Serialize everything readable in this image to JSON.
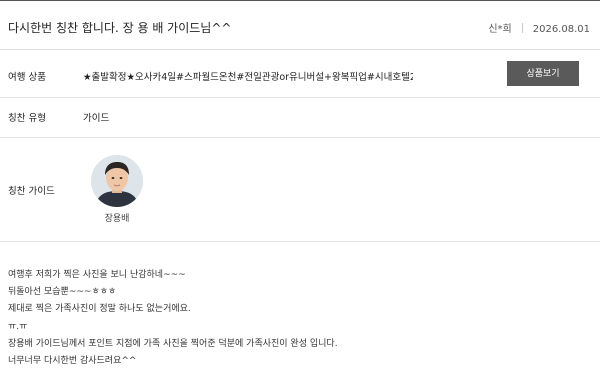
{
  "header": {
    "title": "다시한번 칭찬 합니다. 장 용 배 가이드님^^",
    "author": "신*희",
    "date": "2026.08.01"
  },
  "rows": {
    "product": {
      "label": "여행 상품",
      "value": "★출발확정★오사카4일#스파월드온천#전일관광or유니버설+왕복픽업#시내호텔2...",
      "button": "상품보기"
    },
    "praise_type": {
      "label": "칭찬 유형",
      "value": "가이드"
    },
    "praise_guide": {
      "label": "칭찬 가이드",
      "name": "장용배"
    }
  },
  "body": {
    "lines": [
      "여행후 저희가 찍은 사진을 보니 난감하네~~~",
      "뒤돌아선 모습뿐~~~ㅎㅎㅎ",
      "제대로 찍은 가족사진이 정말 하나도 없는거에요.",
      "ㅠ.ㅠ",
      "장용배 가이드님께서 포인트 지점에 가족 사진을 찍어준 덕분에 가족사진이 완성 입니다.",
      "너무너무 다시한번 감사드려요^^"
    ]
  }
}
